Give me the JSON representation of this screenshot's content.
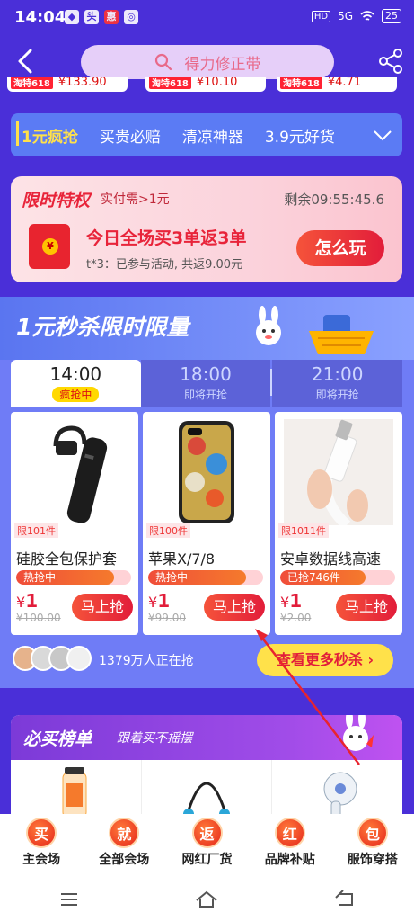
{
  "status": {
    "time": "14:04",
    "battery": "25",
    "signal": "5G",
    "hd": "HD",
    "notif_icons": [
      "fliggy-icon",
      "toutiao-icon",
      "app-red-icon",
      "weibo-icon"
    ]
  },
  "search": {
    "placeholder": "得力修正带"
  },
  "promo_strip": [
    {
      "tag": "淘特618",
      "price": "¥133.90"
    },
    {
      "tag": "淘特618",
      "price": "¥10.10"
    },
    {
      "tag": "淘特618",
      "price": "¥4.71"
    }
  ],
  "tabs": [
    "1元疯抢",
    "买贵必赔",
    "清凉神器",
    "3.9元好货"
  ],
  "privilege": {
    "title": "限时特权",
    "condition": "实付需>1元",
    "remaining": "剩余09:55:45.6",
    "headline": "今日全场买3单返3单",
    "note": "t*3：已参与活动, 共返9.00元",
    "button": "怎么玩"
  },
  "flash": {
    "title": "1元秒杀限时限量",
    "slots": [
      {
        "time": "14:00",
        "status": "疯抢中"
      },
      {
        "time": "18:00",
        "status": "即将开抢"
      },
      {
        "time": "21:00",
        "status": "即将开抢"
      }
    ],
    "products": [
      {
        "limit": "限101件",
        "name": "硅胶全包保护套",
        "progress_label": "热抢中",
        "progress": 0.85,
        "price_symbol": "¥",
        "price": "1",
        "original": "¥100.00",
        "button": "马上抢"
      },
      {
        "limit": "限100件",
        "name": "苹果X/7/8",
        "progress_label": "热抢中",
        "progress": 0.85,
        "price_symbol": "¥",
        "price": "1",
        "original": "¥99.00",
        "button": "马上抢"
      },
      {
        "limit": "限1011件",
        "name": "安卓数据线高速",
        "progress_label": "已抢746件",
        "progress": 0.74,
        "price_symbol": "¥",
        "price": "1",
        "original": "¥2.00",
        "button": "马上抢"
      }
    ],
    "online": "1379万人正在抢",
    "more": "查看更多秒杀 ›"
  },
  "must_buy": {
    "title": "必买榜单",
    "subtitle": "跟着买不摇摆"
  },
  "bottom_nav": [
    {
      "char": "买",
      "label": "主会场"
    },
    {
      "char": "就",
      "label": "全部会场"
    },
    {
      "char": "返",
      "label": "网红厂货"
    },
    {
      "char": "红",
      "label": "品牌补贴"
    },
    {
      "char": "包",
      "label": "服饰穿搭"
    }
  ],
  "colors": {
    "background": "#4a2fd8",
    "accent": "#e21d3a",
    "highlight": "#ffe14a",
    "tab_bar": "#5b7bf4"
  }
}
